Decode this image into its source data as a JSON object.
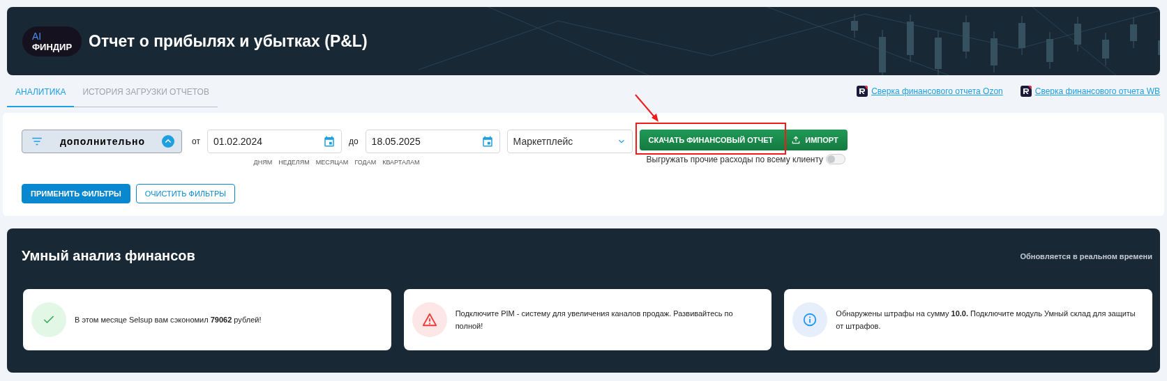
{
  "header": {
    "logo": {
      "line_1": "AI",
      "line_2": "ФИНДИР"
    },
    "title": "Отчет о прибылях и убытках (P&L)"
  },
  "tabs": [
    {
      "label": "АНАЛИТИКА",
      "selected": true
    },
    {
      "label": "ИСТОРИЯ ЗАГРУЗКИ ОТЧЕТОВ",
      "selected": false
    }
  ],
  "links": [
    "Сверка финансового отчета Ozon",
    "Сверка финансового отчета WB"
  ],
  "filters": {
    "more_button": {
      "label": "дополнительно",
      "expanded": true
    },
    "date_from": {
      "label": "от",
      "value": "01.02.2024"
    },
    "date_to": {
      "label": "до",
      "value": "18.05.2025"
    },
    "periods": [
      "ДНЯМ",
      "НЕДЕЛЯМ",
      "МЕСЯЦАМ",
      "ГОДАМ",
      "КВАРТАЛАМ"
    ],
    "marketplace": {
      "placeholder": "Маркетплейс"
    },
    "download_button": "СКАЧАТЬ ФИНАНСОВЫЙ ОТЧЕТ",
    "import_button": "ИМПОРТ",
    "export_toggle": {
      "label": "Выгружать прочие расходы по всему клиенту",
      "on": false
    },
    "apply_button": "ПРИМЕНИТЬ ФИЛЬТРЫ",
    "clear_button": "ОЧИСТИТЬ ФИЛЬТРЫ"
  },
  "insights": {
    "title": "Умный анализ финансов",
    "status": "Обновляется в реальном времени",
    "cards": [
      {
        "kind": "success",
        "text": "В этом месяце Selsup вам сэкономил **79062** рублей!"
      },
      {
        "kind": "warning",
        "text": "Подключите PIM - систему для увеличения каналов продаж. Развивайтесь по полной!"
      },
      {
        "kind": "info",
        "text": "Обнаружены штрафы на сумму **10.0.** Подключите модуль Умный склад для защиты от штрафов."
      }
    ]
  }
}
